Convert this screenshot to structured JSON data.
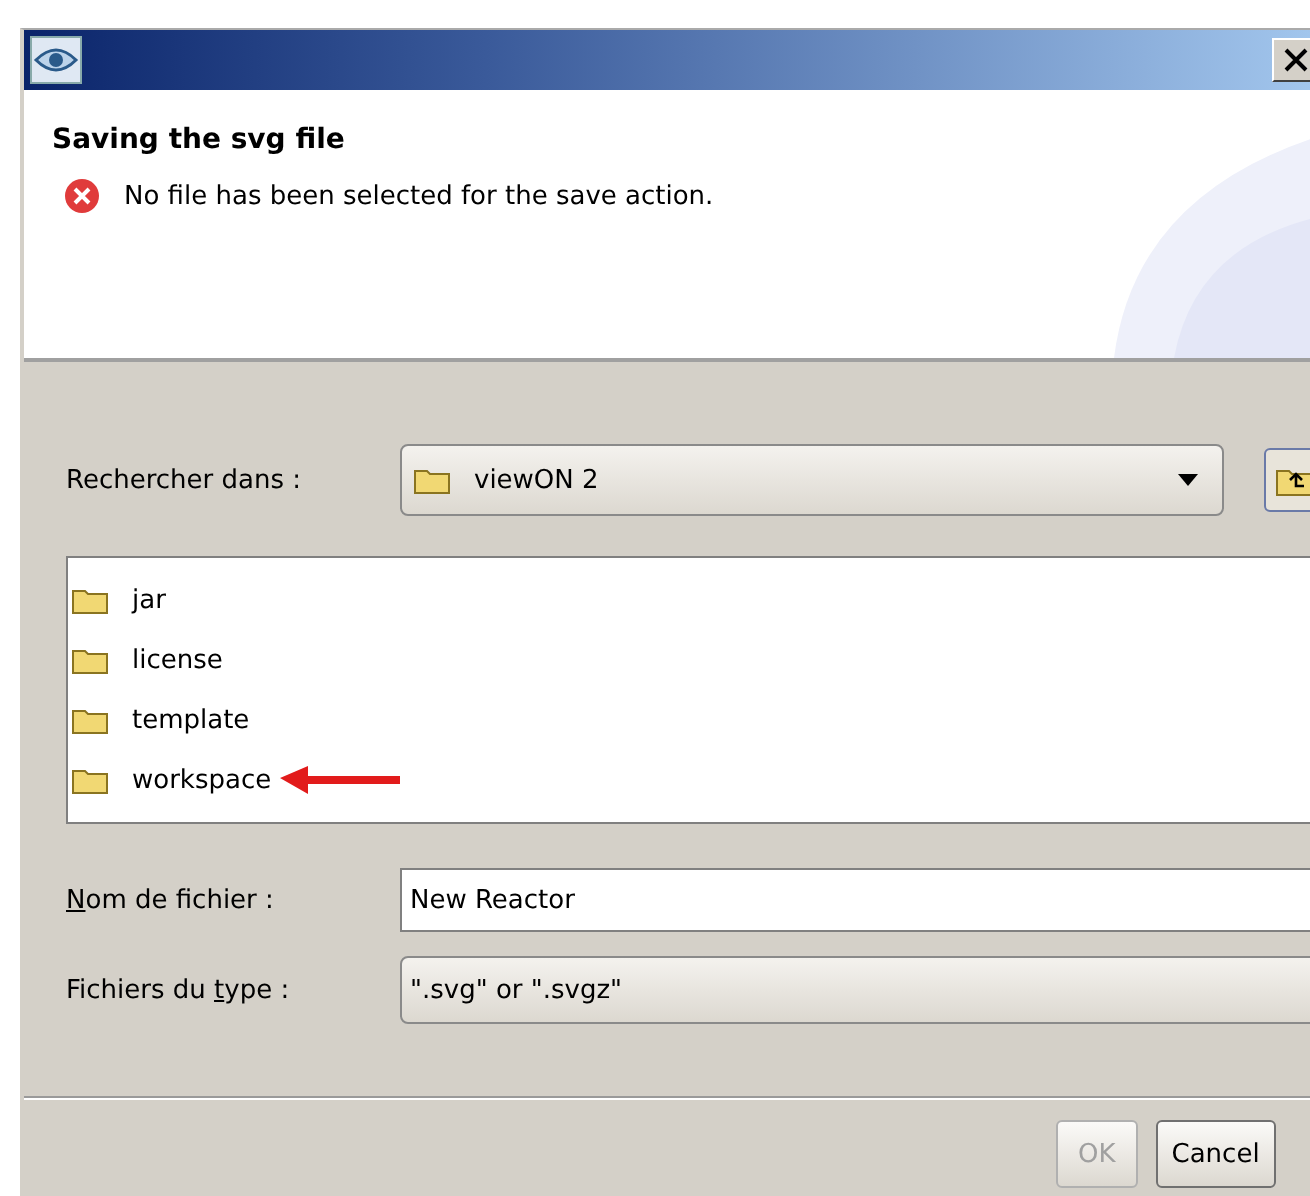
{
  "header": {
    "title": "Saving the svg file",
    "message": {
      "kind": "error",
      "text": "No file has been selected for the save action."
    }
  },
  "look_in": {
    "label": "Rechercher dans :",
    "value": "viewON 2"
  },
  "files": [
    {
      "name": "jar",
      "selected": false
    },
    {
      "name": "license",
      "selected": false
    },
    {
      "name": "template",
      "selected": false
    },
    {
      "name": "workspace",
      "selected": false
    }
  ],
  "file_name": {
    "label_parts": [
      {
        "text": "N",
        "underlined": true
      },
      {
        "text": "om de fichier :",
        "underlined": false
      }
    ],
    "value": "New Reactor"
  },
  "file_type": {
    "label_parts": [
      {
        "text": "Fichiers du ",
        "underlined": false
      },
      {
        "text": "t",
        "underlined": true
      },
      {
        "text": "ype :",
        "underlined": false
      }
    ],
    "value": "\".svg\" or \".svgz\""
  },
  "buttons": [
    {
      "label": "OK",
      "disabled": true
    },
    {
      "label": "Cancel",
      "disabled": false
    }
  ]
}
